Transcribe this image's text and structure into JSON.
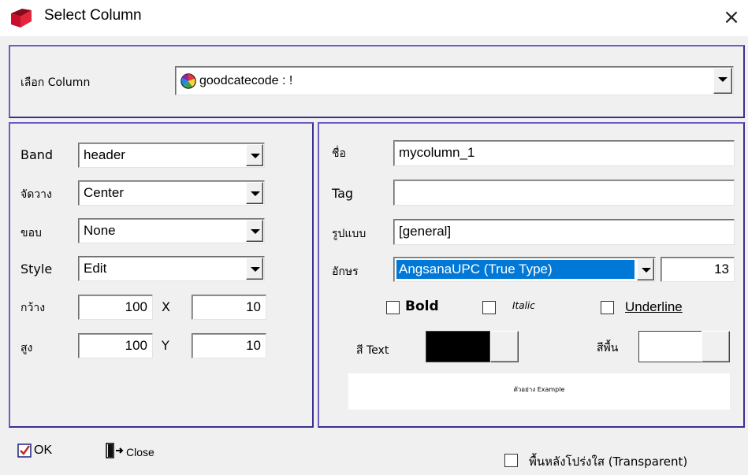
{
  "window": {
    "title": "Select Column",
    "close_glyph": "×"
  },
  "select_column": {
    "label": "เลือก Column",
    "value": "goodcatecode : !",
    "icon": "color-wheel-icon"
  },
  "left": {
    "band_label": "Band",
    "band_value": "header",
    "align_label": "จัดวาง",
    "align_value": "Center",
    "border_label": "ขอบ",
    "border_value": "None",
    "style_label": "Style",
    "style_value": "Edit",
    "width_label": "กว้าง",
    "width_value": "100",
    "x_label": "X",
    "x_value": "10",
    "height_label": "สูง",
    "height_value": "100",
    "y_label": "Y",
    "y_value": "10"
  },
  "right": {
    "name_label": "ชื่อ",
    "name_value": "mycolumn_1",
    "tag_label": "Tag",
    "tag_value": "",
    "format_label": "รูปแบบ",
    "format_value": "[general]",
    "font_label": "อักษร",
    "font_value": "AngsanaUPC (True Type)",
    "font_size": "13",
    "bold_label": "Bold",
    "italic_label": "Italic",
    "underline_label": "Underline",
    "text_color_label": "สี Text",
    "text_color": "#000000",
    "bg_color_label": "สีพื้น",
    "bg_color": "#ffffff",
    "preview_text": "ตัวอย่าง Example"
  },
  "footer": {
    "ok_label": "OK",
    "close_label": "Close",
    "transparent_label": "พื้นหลังโปร่งใส (Transparent)"
  },
  "colors": {
    "frame": "#5a4fb0",
    "selection": "#0078d7"
  }
}
